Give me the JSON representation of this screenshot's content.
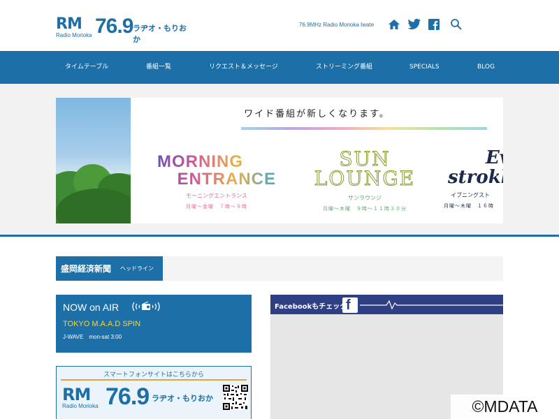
{
  "header": {
    "logo_rm": "RM",
    "logo_rm_sub": "Radio Morioka",
    "logo_freq": "76.9",
    "logo_jp": "ラヂオ・もりおか",
    "tagline": "76.9MHz Radio Morioka Iwate",
    "icons": [
      "home-icon",
      "twitter-icon",
      "facebook-icon",
      "search-icon"
    ]
  },
  "nav": {
    "items": [
      "タイムテーブル",
      "番組一覧",
      "リクエスト＆メッセージ",
      "ストリーミング番組",
      "SPECIALS",
      "BLOG"
    ]
  },
  "banner": {
    "title": "ワイド番組が新しくなります。",
    "programs": [
      {
        "name_line1": "MORNING",
        "name_line2": "ENTRANCE",
        "kana": "モーニングエントランス",
        "time": "月曜〜金曜　７時〜９時"
      },
      {
        "name_line1": "SUN",
        "name_line2": "LOUNGE",
        "kana": "サンラウンジ",
        "time": "月曜〜木曜　９時〜１１時３０分"
      },
      {
        "name_line1": "Ev",
        "name_line2": "strokk",
        "kana": "イブニングスト",
        "time": "月曜〜木曜　１６時"
      }
    ]
  },
  "headline": {
    "title": "盛岡経済新聞",
    "sub": "ヘッドライン"
  },
  "onair": {
    "title": "NOW on AIR",
    "program": "TOKYO M.A.A.D SPIN",
    "station": "J-WAVE　mon-sat 3:00"
  },
  "smartphone": {
    "title": "スマートフォンサイトはこちらから",
    "rm": "RM",
    "rm_sub": "Radio Morioka",
    "freq": "76.9",
    "jp": "ラヂオ・もりおか"
  },
  "facebook": {
    "label": "Facebookもチェック",
    "logo": "f"
  },
  "copyright": "©MDATA",
  "colors": {
    "brand_blue": "#1c6fa7",
    "facebook_navy": "#2f3f84",
    "onair_yellow": "#f5d547"
  }
}
